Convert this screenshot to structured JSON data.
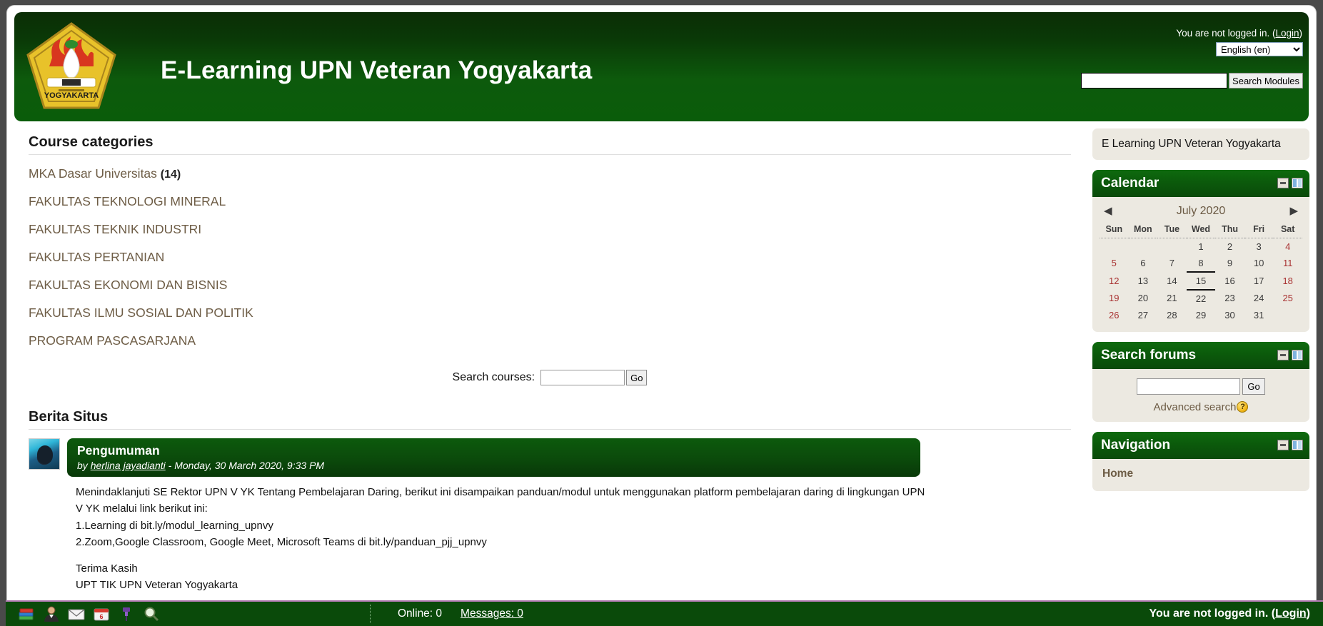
{
  "header": {
    "site_title": "E-Learning UPN Veteran Yogyakarta",
    "login_prefix": "You are not logged in. (",
    "login_link": "Login",
    "login_suffix": ")",
    "language_selected": "English (en)",
    "language_options": [
      "English (en)"
    ],
    "search_input_value": "",
    "search_button": "Search Modules",
    "logo_alt": "Universitas Pembangunan Nasional Veteran Yogyakarta",
    "brand_green": "#0a5c0a"
  },
  "main": {
    "course_categories_title": "Course categories",
    "categories": [
      {
        "label": "MKA Dasar Universitas",
        "count": "(14)"
      },
      {
        "label": "FAKULTAS TEKNOLOGI MINERAL",
        "count": ""
      },
      {
        "label": "FAKULTAS TEKNIK INDUSTRI",
        "count": ""
      },
      {
        "label": "FAKULTAS PERTANIAN",
        "count": ""
      },
      {
        "label": "FAKULTAS EKONOMI DAN BISNIS",
        "count": ""
      },
      {
        "label": "FAKULTAS ILMU SOSIAL DAN POLITIK",
        "count": ""
      },
      {
        "label": "PROGRAM PASCASARJANA",
        "count": ""
      }
    ],
    "search_courses_label": "Search courses:",
    "search_courses_value": "",
    "search_courses_go": "Go",
    "news_title": "Berita Situs",
    "post": {
      "subject": "Pengumuman",
      "by_word": "by",
      "author": "herlina jayadianti",
      "date": "- Monday, 30 March 2020, 9:33 PM",
      "line1": "Menindaklanjuti SE Rektor UPN V YK Tentang Pembelajaran Daring, berikut ini disampaikan panduan/modul untuk menggunakan platform pembelajaran daring di lingkungan UPN",
      "line2": "V YK melalui link berikut ini:",
      "line3": "1.Learning di bit.ly/modul_learning_upnvy",
      "line4": "2.Zoom,Google Classroom, Google Meet, Microsoft Teams di bit.ly/panduan_pjj_upnvy",
      "line5": "Terima Kasih",
      "line6": "UPT TIK UPN Veteran Yogyakarta"
    }
  },
  "sidebar": {
    "intro_block": "E Learning UPN Veteran Yogyakarta",
    "calendar": {
      "title": "Calendar",
      "prev_arrow": "◀",
      "next_arrow": "▶",
      "month_label": "July 2020",
      "weekdays": [
        "Sun",
        "Mon",
        "Tue",
        "Wed",
        "Thu",
        "Fri",
        "Sat"
      ],
      "weeks": [
        [
          "",
          "",
          "",
          "1",
          "2",
          "3",
          "4"
        ],
        [
          "5",
          "6",
          "7",
          "8",
          "9",
          "10",
          "11"
        ],
        [
          "12",
          "13",
          "14",
          "15",
          "16",
          "17",
          "18"
        ],
        [
          "19",
          "20",
          "21",
          "22",
          "23",
          "24",
          "25"
        ],
        [
          "26",
          "27",
          "28",
          "29",
          "30",
          "31",
          ""
        ]
      ],
      "today": "15",
      "weekend_columns": [
        0,
        6
      ]
    },
    "search_forums": {
      "title": "Search forums",
      "input_value": "",
      "go_label": "Go",
      "advanced_label": "Advanced search",
      "help_glyph": "?"
    },
    "navigation": {
      "title": "Navigation",
      "items": [
        "Home"
      ]
    }
  },
  "taskbar": {
    "icons": [
      "books-icon",
      "user-icon",
      "envelope-icon",
      "calendar-icon",
      "pin-icon",
      "magnifier-icon"
    ],
    "online_label": "Online: 0",
    "messages_label": "Messages: 0",
    "login_prefix": "You are not logged in. (",
    "login_link": "Login",
    "login_suffix": ")"
  }
}
